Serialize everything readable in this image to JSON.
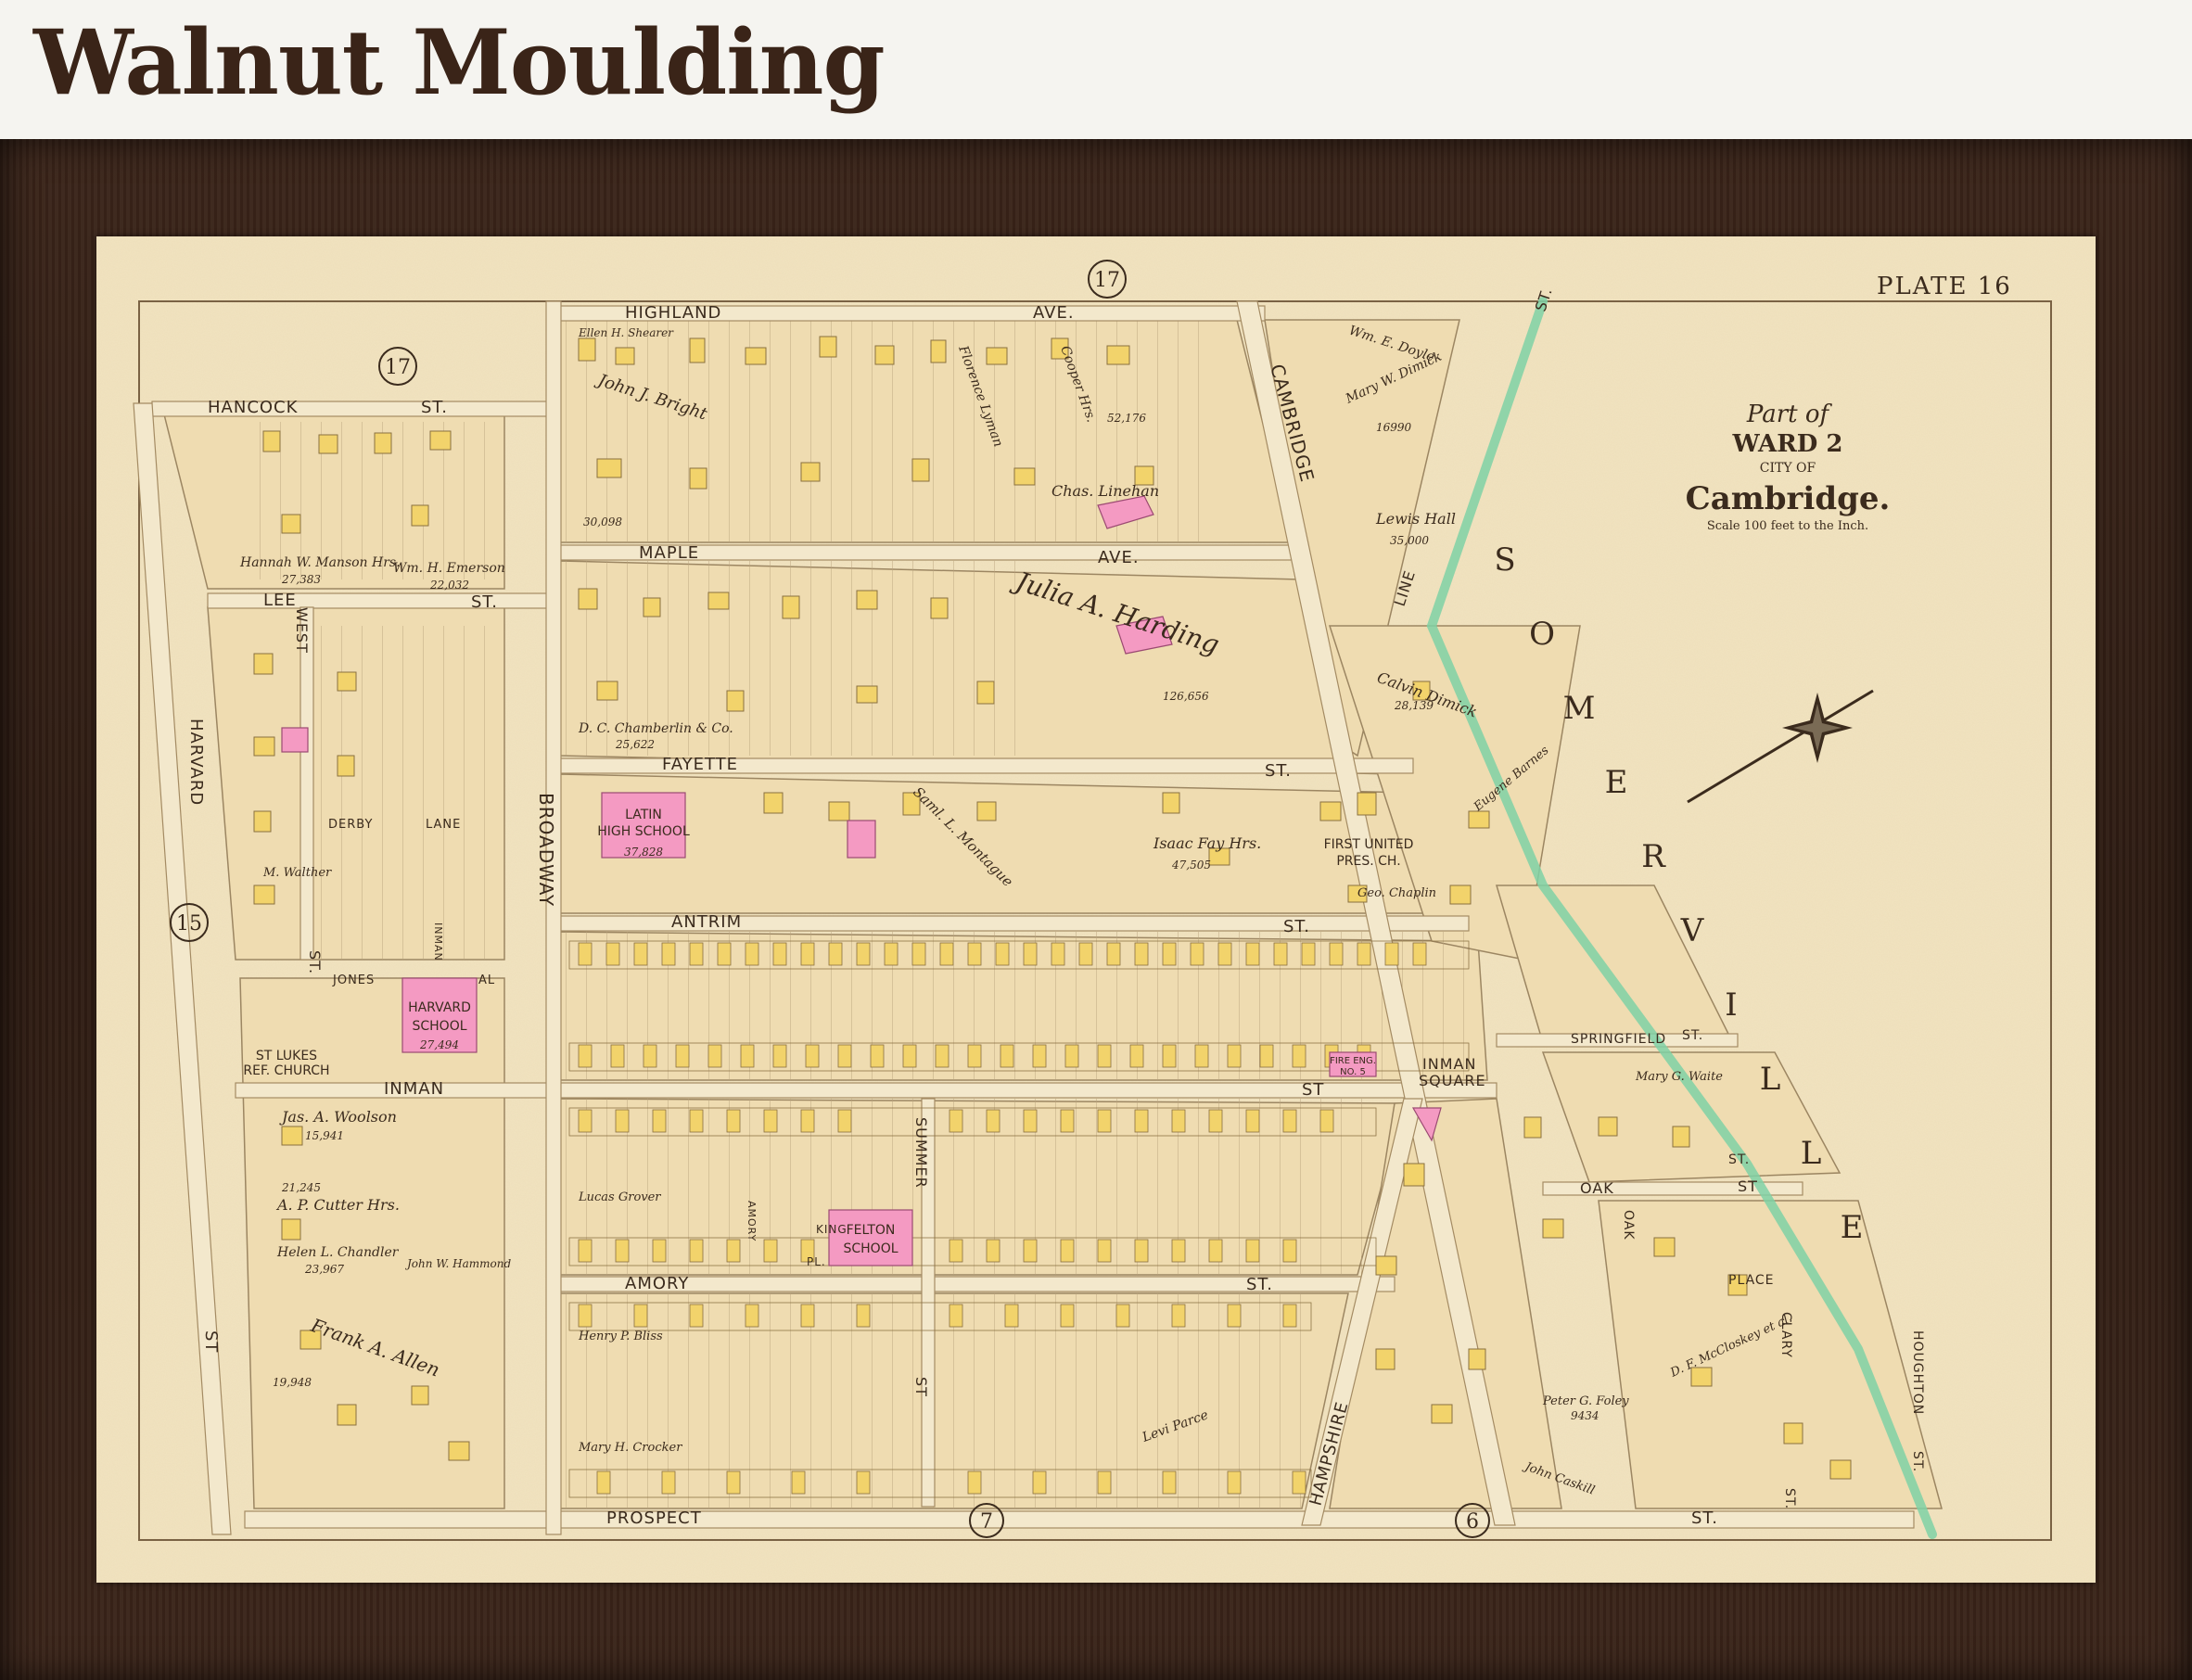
{
  "header": {
    "title": "Walnut Moulding"
  },
  "map": {
    "plate": "PLATE 16",
    "title_block": {
      "line1": "Part of",
      "line2": "WARD 2",
      "line3": "CITY OF",
      "line4": "Cambridge.",
      "scale": "Scale 100 feet to the Inch."
    },
    "ward_circles": [
      "17",
      "17",
      "15",
      "7",
      "6"
    ],
    "streets": {
      "highland": "HIGHLAND",
      "highland_ave": "AVE.",
      "hancock": "HANCOCK",
      "hancock_st": "ST.",
      "maple": "MAPLE",
      "maple_ave": "AVE.",
      "lee": "LEE",
      "lee_st": "ST.",
      "fayette": "FAYETTE",
      "fayette_st": "ST.",
      "antrim": "ANTRIM",
      "antrim_st": "ST.",
      "inman": "INMAN",
      "inman_st": "ST",
      "amory": "AMORY",
      "amory_st": "ST.",
      "prospect": "PROSPECT",
      "prospect_st": "ST.",
      "harvard": "HARVARD",
      "harvard_st": "ST",
      "west": "WEST",
      "west_st": "ST.",
      "broadway": "BROADWAY",
      "cambridge": "CAMBRIDGE",
      "line": "LINE",
      "line_st": "ST.",
      "summer": "SUMMER",
      "summer_st": "ST",
      "hampshire": "HAMPSHIRE",
      "springfield": "SPRINGFIELD",
      "springfield_st": "ST.",
      "oak": "OAK",
      "oak_st": "ST",
      "oak_vertical": "OAK",
      "place": "PLACE",
      "clary": "CLARY",
      "clary_st": "ST.",
      "houghton": "HOUGHTON",
      "houghton_st": "ST.",
      "derby": "DERBY",
      "lane": "LANE",
      "jones": "JONES",
      "al": "AL",
      "inman_pl": "INMAN",
      "amory_pl": "AMORY",
      "king": "KING",
      "pl": "PL.",
      "inman_square_1": "INMAN",
      "inman_square_2": "SQUARE",
      "st_small": "ST."
    },
    "somerville": [
      "S",
      "O",
      "M",
      "E",
      "R",
      "V",
      "I",
      "L",
      "L",
      "E"
    ],
    "buildings": {
      "latin_1": "LATIN",
      "latin_2": "HIGH SCHOOL",
      "harvard_1": "HARVARD",
      "harvard_2": "SCHOOL",
      "felton_1": "FELTON",
      "felton_2": "SCHOOL",
      "first_united_1": "FIRST UNITED",
      "first_united_2": "PRES. CH.",
      "st_lukes_1": "ST LUKES",
      "st_lukes_2": "REF. CHURCH",
      "fire_eng_1": "FIRE ENG.",
      "fire_eng_2": "NO. 5"
    },
    "owners": {
      "chas_linehan": "Chas. Linehan",
      "julia_harding": "Julia A. Harding",
      "isaac_fay": "Isaac Fay Hrs.",
      "lewis_hall": "Lewis Hall",
      "mary_dimick": "Mary W. Dimick",
      "calvin_dimick": "Calvin Dimick",
      "wm_doyle": "Wm. E. Doyle",
      "hannah_manson": "Hannah W. Manson Hrs.",
      "wm_emerson": "Wm. H. Emerson",
      "cooper_hrs": "Cooper Hrs.",
      "florence_lyman": "Florence Lyman",
      "john_bright": "John J. Bright",
      "chamberlin": "D. C. Chamberlin & Co.",
      "jas_woolson": "Jas. A. Woolson",
      "cutter_hrs": "A. P. Cutter Hrs.",
      "helen_chandler": "Helen L. Chandler",
      "frank_allen": "Frank A. Allen",
      "geo_chaplin": "Geo. Chaplin",
      "henry_bliss": "Henry P. Bliss",
      "mary_crocker": "Mary H. Crocker",
      "peter_foley": "Peter G. Foley",
      "mary_waite": "Mary G. Waite",
      "eugene_barnes": "Eugene Barnes",
      "m_walther": "M. Walther",
      "lucas_grover": "Lucas Grover",
      "samuel_montague": "Saml. L. Montague",
      "levi_parce": "Levi Parce",
      "john_hammond": "John W. Hammond",
      "john_caskill": "John Caskill",
      "d_mcaskey": "D. F. McCloskey et al.",
      "ellen_shearer": "Ellen H. Shearer"
    },
    "areas": {
      "chas_linehan": "52,176",
      "julia_harding": "126,656",
      "isaac_fay": "47,505",
      "lewis_hall": "35,000",
      "mary_dimick": "16990",
      "calvin_dimick": "28,139",
      "hannah_manson": "27,383",
      "wm_emerson": "22,032",
      "jas_woolson": "15,941",
      "cutter_hrs": "21,245",
      "helen_chandler": "23,967",
      "latin": "37,828",
      "harvard": "27,494",
      "john_bright": "30,098",
      "chamberlin": "25,622",
      "peter_foley": "9434",
      "frank_allen": "19,948"
    },
    "colors": {
      "paper": "#f1e3c0",
      "street": "#f3e8cc",
      "lot_line": "#9c8662",
      "building_yellow": "#f2d36b",
      "building_pink": "#f49ac2",
      "ink": "#3b2b1d",
      "green_boundary": "#7fd1a6"
    }
  }
}
